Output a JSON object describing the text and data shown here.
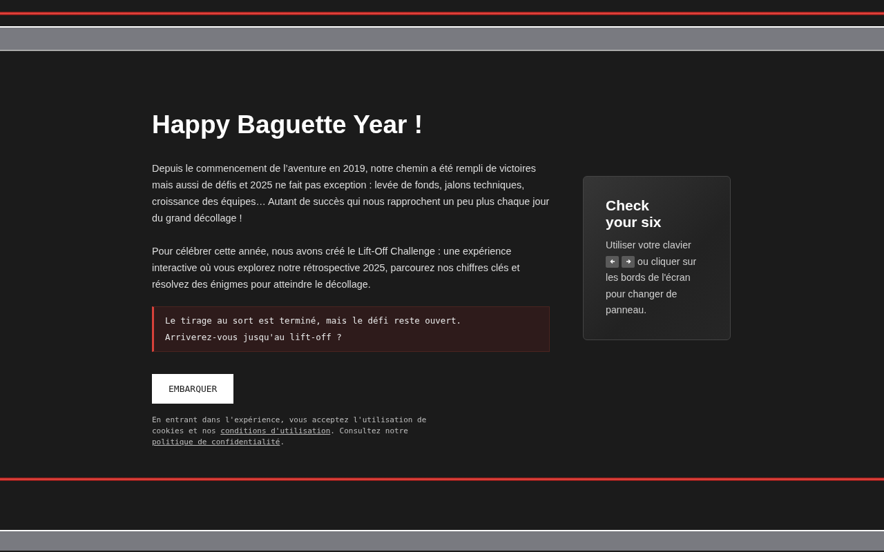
{
  "intro": {
    "title": "Happy Baguette Year !",
    "paragraphs": [
      "Depuis le commencement de l’aventure en 2019, notre chemin a été rempli de victoires mais aussi de défis et 2025 ne fait pas exception : levée de fonds, jalons techniques, croissance des équipes… Autant de succès qui nous rapprochent un peu plus chaque jour du grand décollage !",
      "Pour célébrer cette année, nous avons créé le Lift-Off Challenge : une expérience interactive où vous explorez notre rétrospective 2025, parcourez nos chiffres clés et résolvez des énigmes pour atteindre le décollage."
    ],
    "notice": [
      "Le tirage au sort est terminé, mais le défi reste ouvert.",
      "Arriverez-vous jusqu'au lift-off ?"
    ],
    "button": "EMBARQUER",
    "consent": {
      "before": "En entrant dans l'expérience, vous acceptez l'utilisation de cookies et nos ",
      "link_terms": "conditions d'utilisation",
      "middle": ". Consultez notre ",
      "link_privacy": "politique de confidentialité",
      "after": "."
    }
  },
  "hint_card": {
    "title": "Check your six",
    "before": "Utiliser votre clavier",
    "after": "ou cliquer sur",
    "rest": "les bords de l'écran pour changer de panneau."
  }
}
